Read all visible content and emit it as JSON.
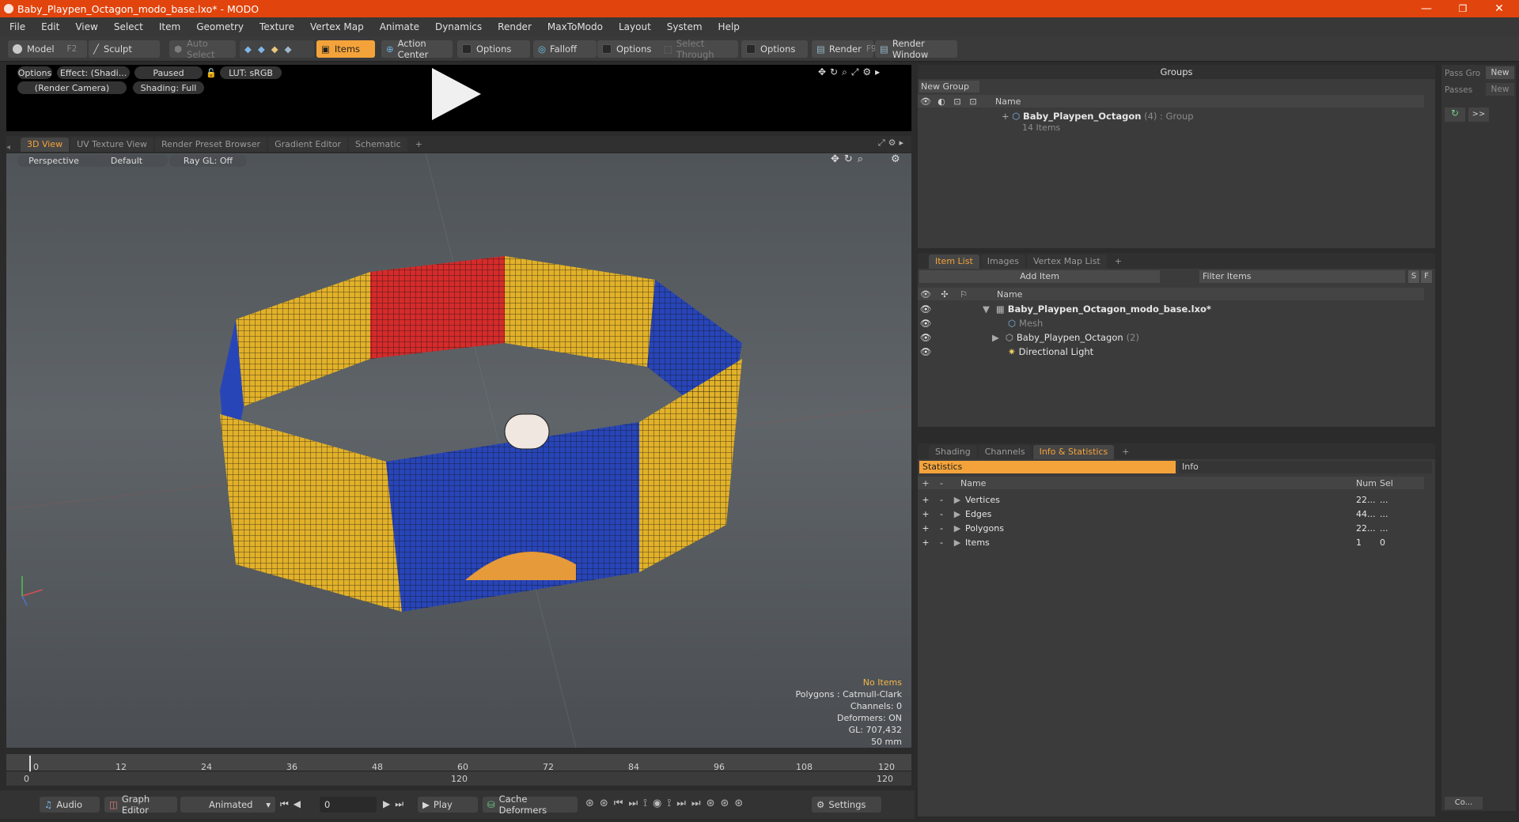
{
  "window": {
    "title": "Baby_Playpen_Octagon_modo_base.lxo* - MODO",
    "minimize": "—",
    "maximize": "❐",
    "close": "✕"
  },
  "menu": [
    "File",
    "Edit",
    "View",
    "Select",
    "Item",
    "Geometry",
    "Texture",
    "Vertex Map",
    "Animate",
    "Dynamics",
    "Render",
    "MaxToModo",
    "Layout",
    "System",
    "Help"
  ],
  "toolbar": {
    "model": "Model",
    "model_key": "F2",
    "sculpt": "Sculpt",
    "auto_select": "Auto Select",
    "items": "Items",
    "action_center": "Action Center",
    "options1": "Options",
    "falloff": "Falloff",
    "options2": "Options",
    "select_through": "Select Through",
    "options3": "Options",
    "render": "Render",
    "render_key": "F9",
    "render_window": "Render Window"
  },
  "preview": {
    "options": "Options",
    "effect": "Effect: (Shadi...",
    "paused": "Paused",
    "lut": "LUT: sRGB",
    "camera": "(Render Camera)",
    "shading": "Shading: Full"
  },
  "viewtabs": [
    "3D View",
    "UV Texture View",
    "Render Preset Browser",
    "Gradient Editor",
    "Schematic",
    "+"
  ],
  "viewport": {
    "perspective": "Perspective",
    "default": "Default",
    "raygl": "Ray GL: Off",
    "info_title": "No Items",
    "polygons": "Polygons : Catmull-Clark",
    "channels": "Channels: 0",
    "deformers": "Deformers: ON",
    "gl": "GL: 707,432",
    "focal": "50 mm"
  },
  "timeline": {
    "ticks": [
      "0",
      "12",
      "24",
      "36",
      "48",
      "60",
      "72",
      "84",
      "96",
      "108",
      "120"
    ],
    "range_start": "0",
    "range_mid": "120",
    "range_end": "120"
  },
  "bottom": {
    "audio": "Audio",
    "graph_editor": "Graph Editor",
    "animated": "Animated",
    "frame": "0",
    "play": "Play",
    "cache": "Cache Deformers",
    "settings": "Settings"
  },
  "groups": {
    "header": "Groups",
    "new_group": "New Group",
    "col_name": "Name",
    "group_name": "Baby_Playpen_Octagon",
    "group_count": "(4)",
    "group_type": ": Group",
    "group_items": "14 Items"
  },
  "passes": {
    "pass_label": "Pass Gro",
    "new1": "New",
    "passes_label": "Passes",
    "new2": "New",
    "arrow": ">>"
  },
  "itemlist": {
    "tabs": [
      "Item List",
      "Images",
      "Vertex Map List",
      "+"
    ],
    "add_item": "Add Item",
    "filter": "Filter Items",
    "s": "S",
    "f": "F",
    "col_name": "Name",
    "rows": [
      {
        "label": "Baby_Playpen_Octagon_modo_base.lxo*",
        "extra": ""
      },
      {
        "label": "Mesh",
        "extra": ""
      },
      {
        "label": "Baby_Playpen_Octagon",
        "extra": "(2)"
      },
      {
        "label": "Directional Light",
        "extra": ""
      }
    ]
  },
  "stats": {
    "tabs": [
      "Shading",
      "Channels",
      "Info & Statistics",
      "+"
    ],
    "statistics": "Statistics",
    "info": "Info",
    "col_name": "Name",
    "col_num": "Num",
    "col_sel": "Sel",
    "rows": [
      {
        "name": "Vertices",
        "num": "22...",
        "sel": "..."
      },
      {
        "name": "Edges",
        "num": "44...",
        "sel": "..."
      },
      {
        "name": "Polygons",
        "num": "22...",
        "sel": "..."
      },
      {
        "name": "Items",
        "num": "1",
        "sel": "0"
      }
    ]
  },
  "side_bottom": {
    "co": "Co..."
  }
}
